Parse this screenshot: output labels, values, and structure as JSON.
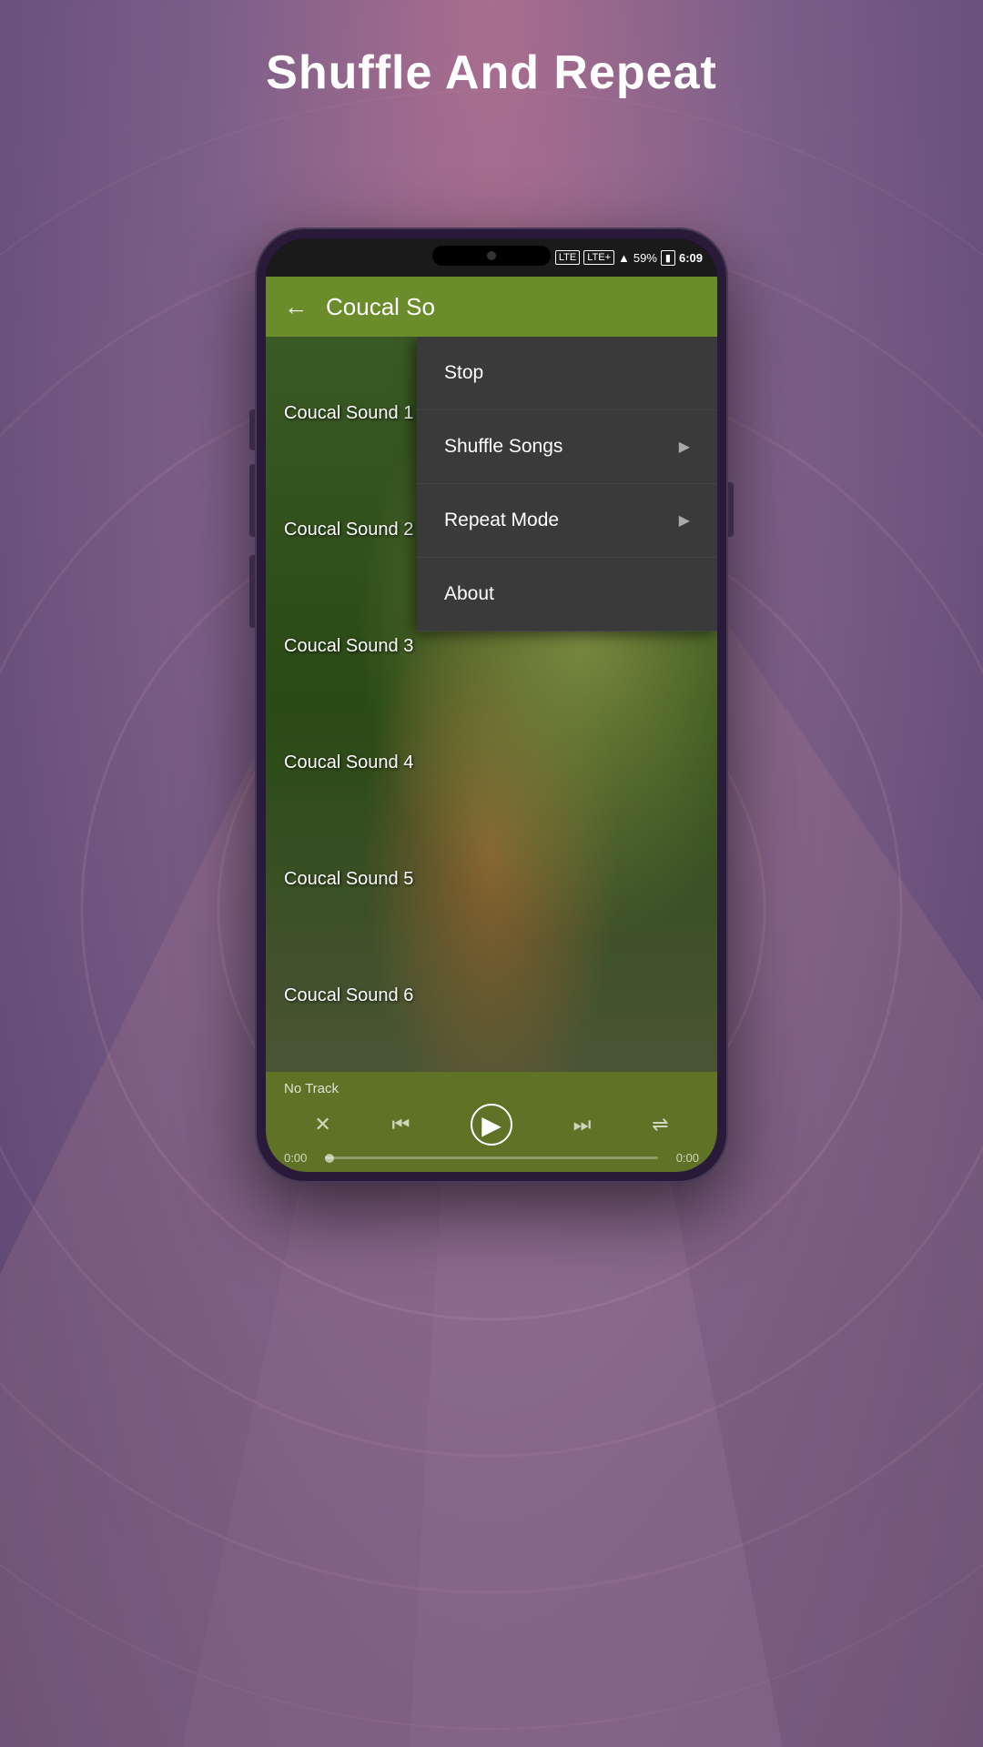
{
  "page": {
    "title": "Shuffle And Repeat",
    "background_color": "#7a5f8a"
  },
  "status_bar": {
    "signal": "LTE",
    "signal2": "LTE+",
    "battery": "59%",
    "time": "6:09"
  },
  "app_header": {
    "title": "Coucal So",
    "back_label": "←"
  },
  "song_list": {
    "items": [
      {
        "label": "Coucal Sound 1"
      },
      {
        "label": "Coucal Sound 2"
      },
      {
        "label": "Coucal Sound 3"
      },
      {
        "label": "Coucal Sound 4"
      },
      {
        "label": "Coucal Sound 5"
      },
      {
        "label": "Coucal Sound 6"
      }
    ]
  },
  "dropdown_menu": {
    "items": [
      {
        "label": "Stop",
        "has_submenu": false
      },
      {
        "label": "Shuffle Songs",
        "has_submenu": true
      },
      {
        "label": "Repeat Mode",
        "has_submenu": true
      },
      {
        "label": "About",
        "has_submenu": false
      }
    ]
  },
  "player": {
    "track_name": "No Track",
    "time_start": "0:00",
    "time_end": "0:00",
    "controls": {
      "shuffle": "⤢",
      "prev": "⏮",
      "play": "▶",
      "next": "⏭",
      "repeat": "⇌"
    }
  }
}
